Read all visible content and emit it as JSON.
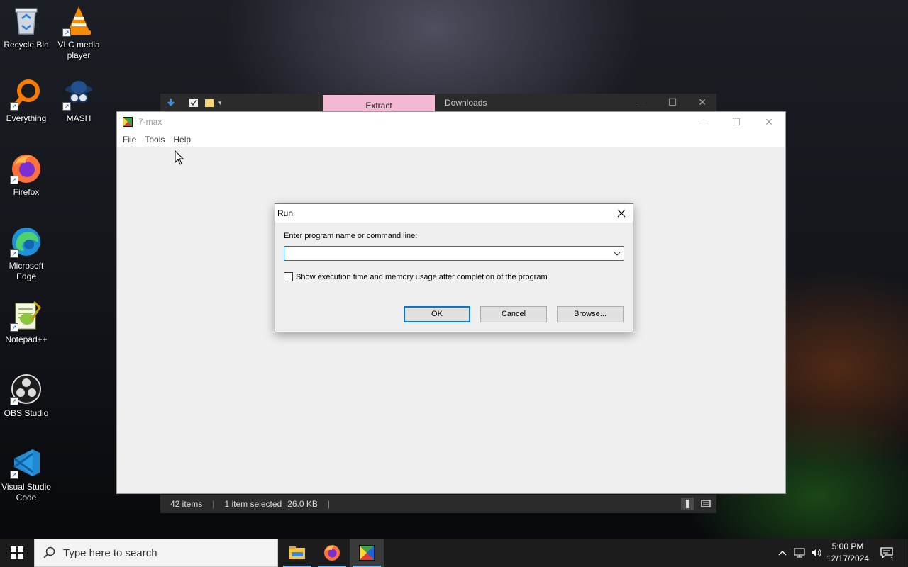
{
  "desktop": {
    "icons": [
      {
        "label": "Recycle Bin",
        "icon": "recycle-bin-icon"
      },
      {
        "label": "VLC media player",
        "icon": "vlc-icon"
      },
      {
        "label": "Everything",
        "icon": "everything-icon"
      },
      {
        "label": "MASH",
        "icon": "mash-icon"
      },
      {
        "label": "Firefox",
        "icon": "firefox-icon"
      },
      {
        "label": "Microsoft Edge",
        "icon": "edge-icon"
      },
      {
        "label": "Notepad++",
        "icon": "notepadpp-icon"
      },
      {
        "label": "OBS Studio",
        "icon": "obs-icon"
      },
      {
        "label": "Visual Studio Code",
        "icon": "vscode-icon"
      }
    ]
  },
  "background_explorer": {
    "ribbon_tab": "Extract",
    "title": "Downloads",
    "status": {
      "items": "42 items",
      "selected": "1 item selected",
      "size": "26.0 KB"
    }
  },
  "main_window": {
    "title": "7-max",
    "menu": [
      "File",
      "Tools",
      "Help"
    ]
  },
  "run_dialog": {
    "title": "Run",
    "prompt": "Enter program name or command line:",
    "command_value": "",
    "checkbox_label": "Show execution time and memory usage after completion of the program",
    "checkbox_checked": false,
    "buttons": {
      "ok": "OK",
      "cancel": "Cancel",
      "browse": "Browse..."
    }
  },
  "taskbar": {
    "search_placeholder": "Type here to search",
    "pinned": [
      "file-explorer-icon",
      "firefox-icon",
      "7-max-icon"
    ],
    "clock_time": "5:00 PM",
    "clock_date": "12/17/2024",
    "notification_count": "1"
  },
  "colors": {
    "accent": "#0078d7",
    "extract_tab": "#f3b9d4",
    "taskbar": "#1c1c1c"
  }
}
